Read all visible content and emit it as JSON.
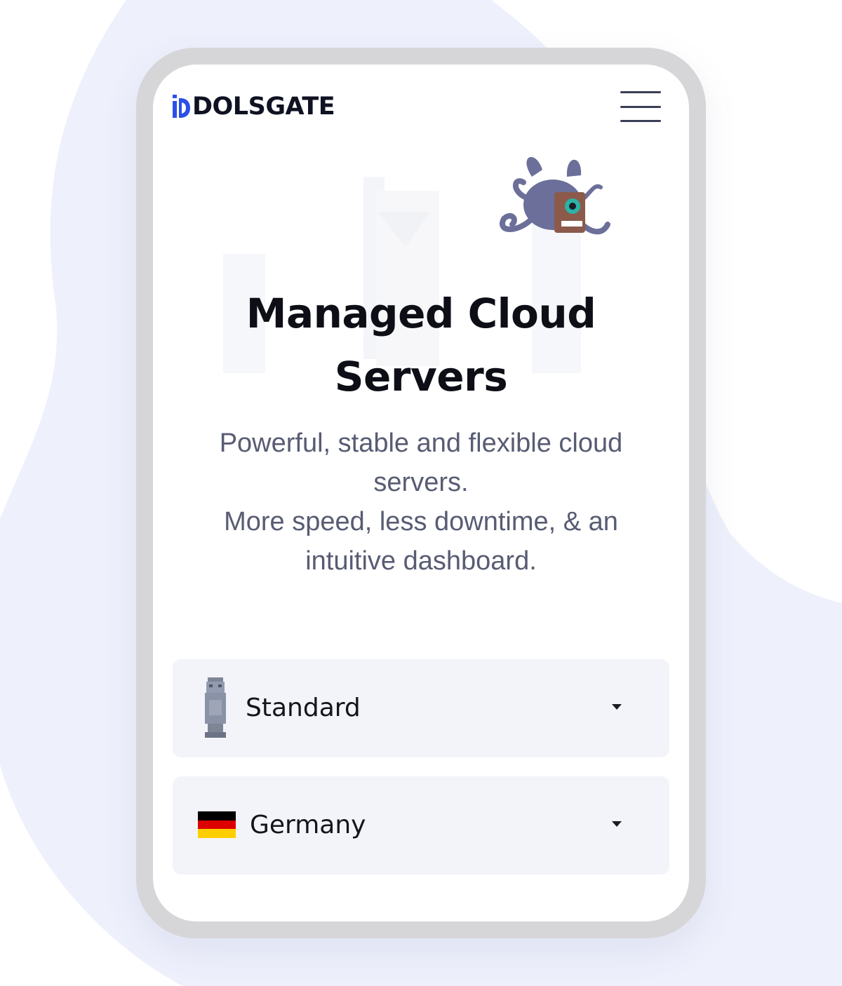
{
  "brand": {
    "logo_text": "DOLSGATE",
    "logo_mark_color": "#2b50e8"
  },
  "header": {
    "menu_icon": "hamburger-menu-icon"
  },
  "hero": {
    "title_line1": "Managed Cloud",
    "title_line2": "Servers",
    "subtitle_line1": "Powerful, stable and flexible cloud servers.",
    "subtitle_line2": "More speed, less downtime, & an intuitive dashboard.",
    "illustration": "tentacle-monster-robot-illustration"
  },
  "selectors": {
    "plan": {
      "icon": "statue-icon",
      "selected": "Standard"
    },
    "location": {
      "icon": "germany-flag-icon",
      "selected": "Germany"
    },
    "caret_icon": "caret-down-icon"
  },
  "colors": {
    "backdrop_blob": "#eef0fc",
    "phone_frame": "#d6d6d9",
    "select_bg": "#f3f4f9",
    "subtitle_text": "#585c73",
    "title_text": "#0e0f16"
  }
}
